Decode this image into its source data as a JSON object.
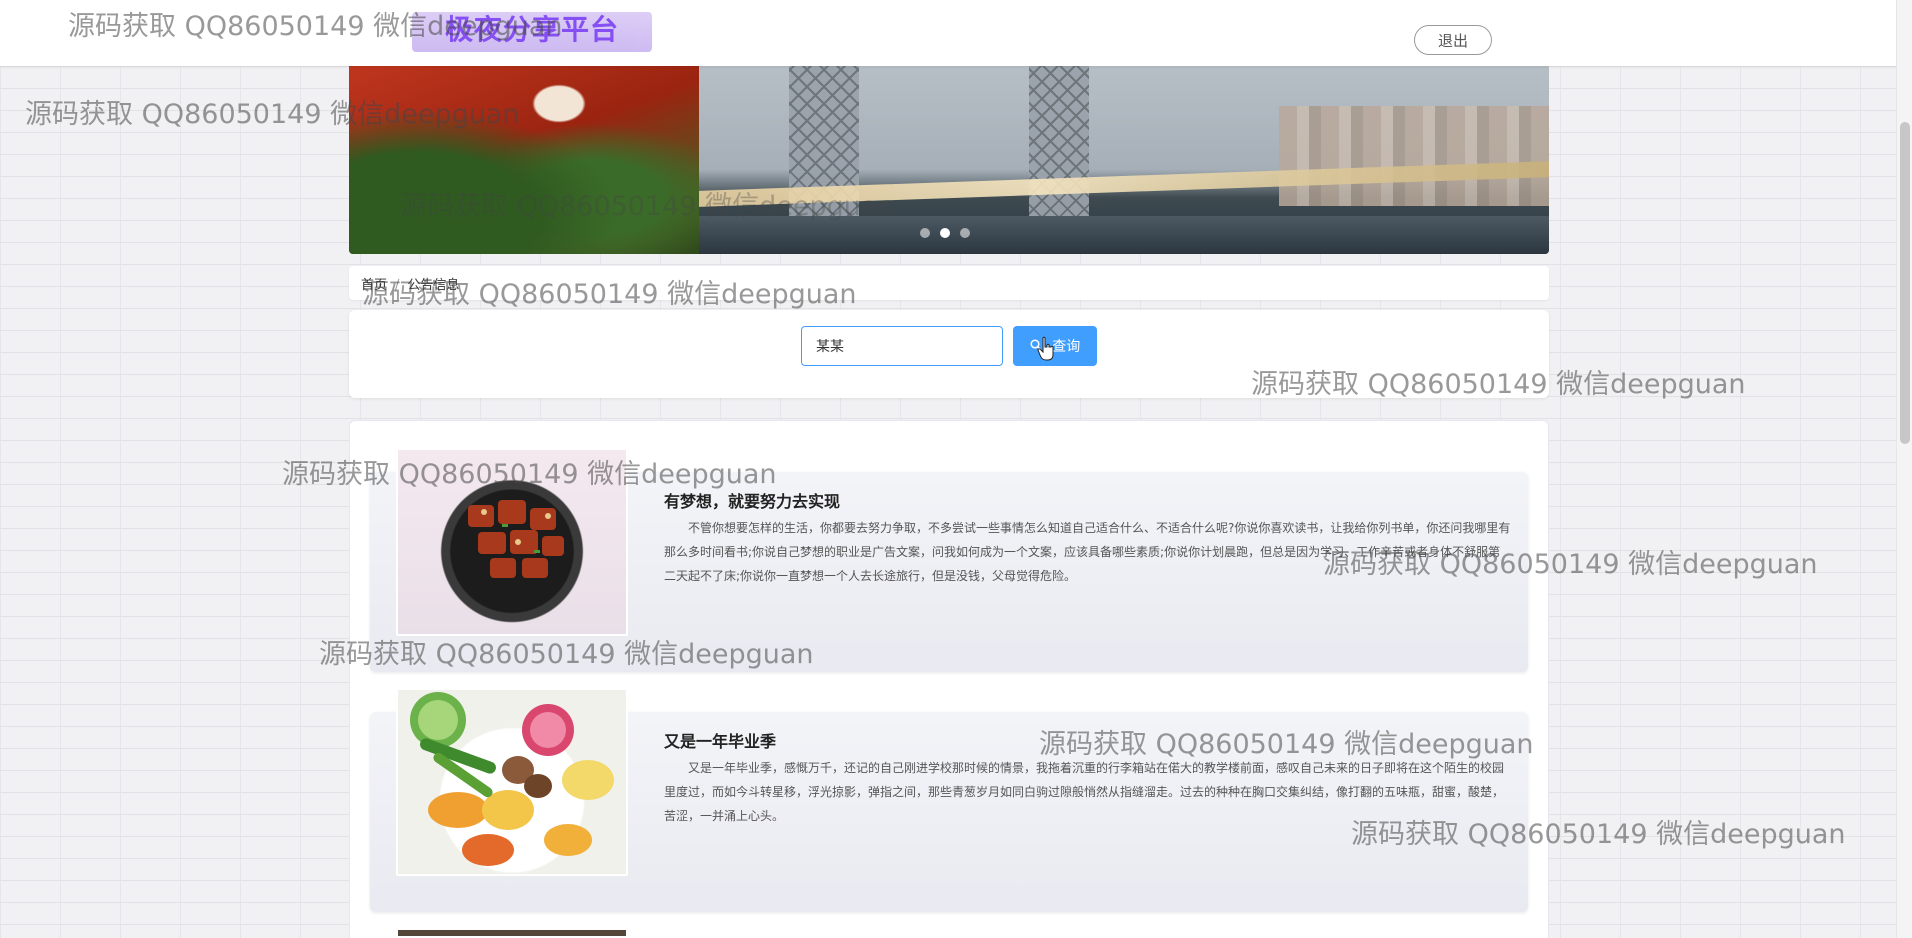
{
  "header": {
    "site_title": "极夜分享平台",
    "logout_label": "退出"
  },
  "breadcrumb": {
    "home": "首页",
    "current": "公告信息"
  },
  "search": {
    "value": "某某",
    "button_label": "查询",
    "button_icon": "search-icon"
  },
  "articles": [
    {
      "title": "有梦想，就要努力去实现",
      "body": "不管你想要怎样的生活，你都要去努力争取，不多尝试一些事情怎么知道自己适合什么、不适合什么呢?你说你喜欢读书，让我给你列书单，你还问我哪里有那么多时间看书;你说自己梦想的职业是广告文案，问我如何成为一个文案，应该具备哪些素质;你说你计划晨跑，但总是因为学习、工作辛苦或者身体不舒服第二天起不了床;你说你一直梦想一个人去长途旅行，但是没钱，父母觉得危险。",
      "image": "braised-pork-dish"
    },
    {
      "title": "又是一年毕业季",
      "body": "又是一年毕业季，感慨万千，还记的自己刚进学校那时候的情景，我拖着沉重的行李箱站在偌大的教学楼前面，感叹自己未来的日子即将在这个陌生的校园里度过，而如今斗转星移，浮光掠影，弹指之间，那些青葱岁月如同白驹过隙般悄然从指缝溜走。过去的种种在胸口交集纠结，像打翻的五味瓶，甜蜜，酸楚，苦涩，一并涌上心头。",
      "image": "vegetable-chips-plate"
    }
  ],
  "watermark_text": "源码获取 QQ86050149 微信deepguan",
  "colors": {
    "primary": "#409eff",
    "title_purple": "#7a3cf2",
    "card_bg": "#eeeff4"
  }
}
